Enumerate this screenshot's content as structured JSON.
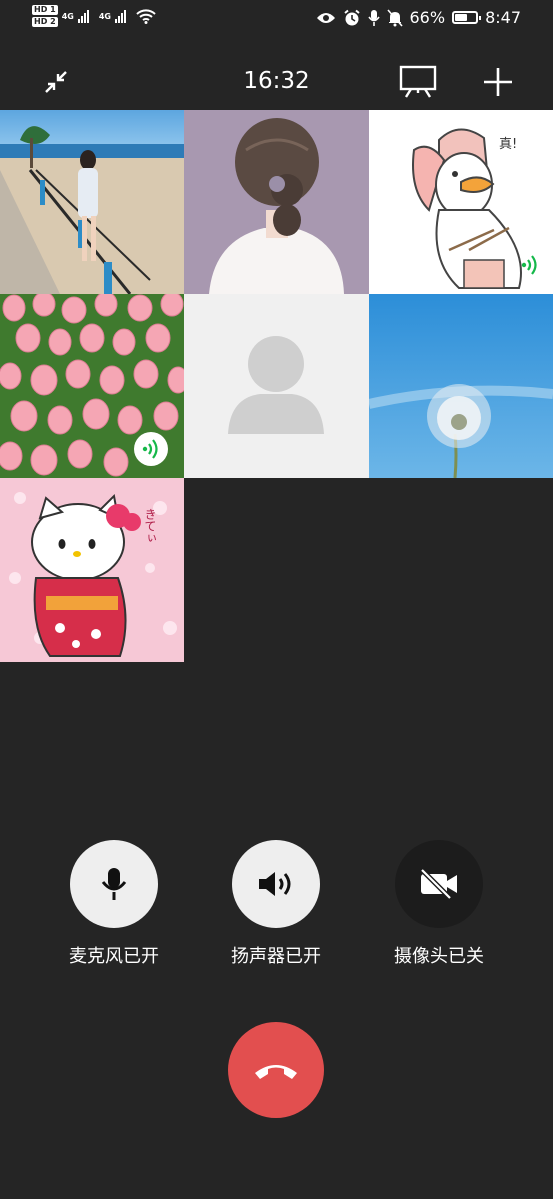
{
  "status_bar": {
    "hd1": "HD 1",
    "hd2": "HD 2",
    "net1": "4G",
    "net2": "4G",
    "battery_text": "66%",
    "battery_level": 0.66,
    "time": "8:47"
  },
  "call": {
    "duration": "16:32"
  },
  "controls": {
    "mic_label": "麦克风已开",
    "speaker_label": "扬声器已开",
    "camera_label": "摄像头已关"
  },
  "tiles": [
    {
      "name": "beach-photo",
      "speaking": false
    },
    {
      "name": "girl-back-illustration",
      "speaking": false
    },
    {
      "name": "goose-sticker",
      "speaking": true
    },
    {
      "name": "tulips-photo",
      "speaking": true
    },
    {
      "name": "default-avatar",
      "speaking": false
    },
    {
      "name": "dandelion-photo",
      "speaking": false
    },
    {
      "name": "hello-kitty",
      "speaking": false
    }
  ],
  "goose_sticker_text": "真!",
  "kitty_sticker_text": "きてぃ",
  "colors": {
    "background": "#252525",
    "hangup": "#e24f4f",
    "control_on": "#eeeeee",
    "control_off": "#1c1c1c",
    "speaking_indicator": "#15b84a"
  }
}
